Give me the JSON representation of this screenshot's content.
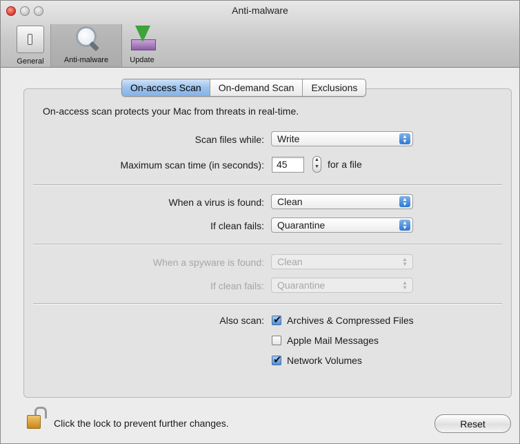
{
  "window": {
    "title": "Anti-malware"
  },
  "toolbar": {
    "items": [
      {
        "label": "General",
        "icon": "switch-icon",
        "selected": false
      },
      {
        "label": "Anti-malware",
        "icon": "magnifier-icon",
        "selected": true
      },
      {
        "label": "Update",
        "icon": "download-arrow-icon",
        "selected": false
      }
    ]
  },
  "tabs": [
    {
      "label": "On-access Scan",
      "active": true
    },
    {
      "label": "On-demand Scan",
      "active": false
    },
    {
      "label": "Exclusions",
      "active": false
    }
  ],
  "description": "On-access scan protects your Mac from threats in real-time.",
  "scan_files": {
    "label": "Scan files while:",
    "value": "Write"
  },
  "max_scan_time": {
    "label": "Maximum scan time (in seconds):",
    "value": "45",
    "suffix": "for a file"
  },
  "virus": {
    "found_label": "When a virus is found:",
    "found_value": "Clean",
    "fails_label": "If clean fails:",
    "fails_value": "Quarantine"
  },
  "spyware": {
    "found_label": "When a spyware is found:",
    "found_value": "Clean",
    "fails_label": "If clean fails:",
    "fails_value": "Quarantine",
    "disabled": true
  },
  "also_scan": {
    "label": "Also scan:",
    "options": [
      {
        "label": "Archives & Compressed Files",
        "checked": true
      },
      {
        "label": "Apple Mail Messages",
        "checked": false
      },
      {
        "label": "Network Volumes",
        "checked": true
      }
    ]
  },
  "footer": {
    "lock_text": "Click the lock to prevent further changes.",
    "reset_label": "Reset"
  },
  "colors": {
    "active_tab": "#9cc2ec",
    "popup_arrows": "#2d78d4"
  }
}
